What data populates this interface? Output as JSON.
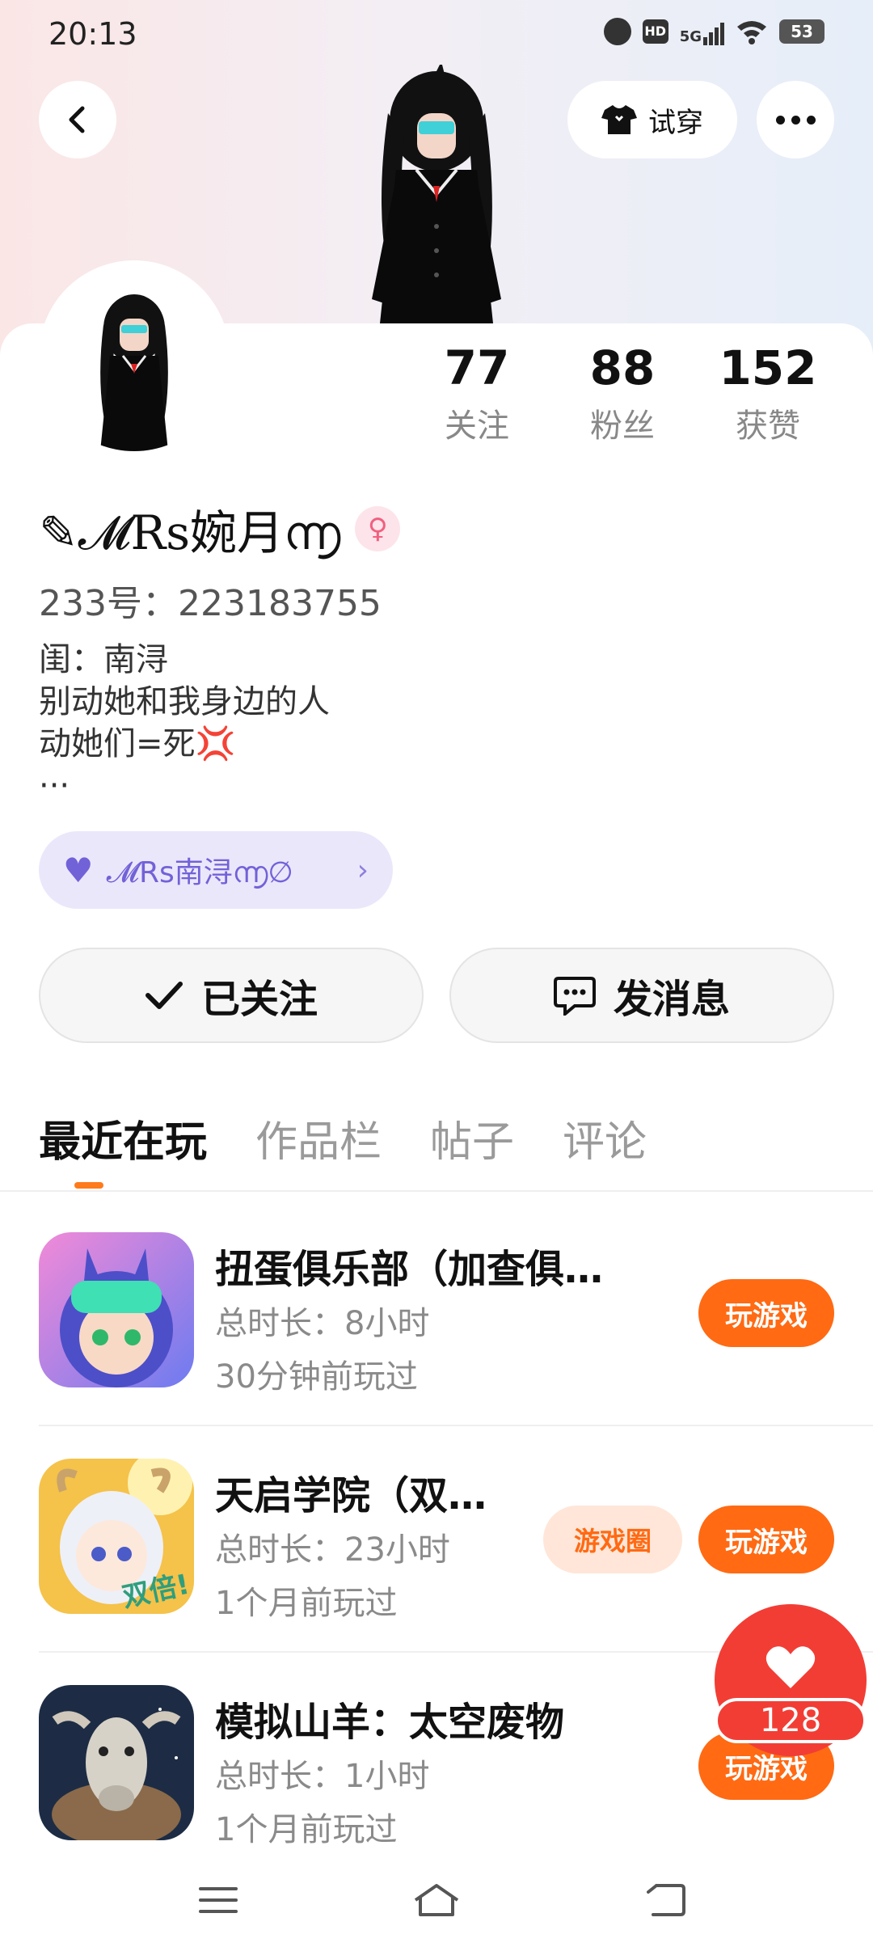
{
  "status_bar": {
    "time": "20:13",
    "network": "5G",
    "hd_label": "HD",
    "battery": "53"
  },
  "header": {
    "tryon_label": "试穿",
    "icons": [
      "back-icon",
      "tshirt-icon",
      "more-icon"
    ]
  },
  "profile": {
    "stats": [
      {
        "value": "77",
        "label": "关注"
      },
      {
        "value": "88",
        "label": "粉丝"
      },
      {
        "value": "152",
        "label": "获赞"
      }
    ],
    "username": "✎𝓜Rs婉月൬",
    "gender_symbol": "♀",
    "uid": "233号：223183755",
    "bio_lines": [
      "闺：南浔",
      "别动她和我身边的人",
      "动她们=死"
    ],
    "bio_more": "···",
    "cp_name": "𝓜Rs南浔൬∅"
  },
  "actions": {
    "follow_label": "已关注",
    "message_label": "发消息"
  },
  "tabs": [
    {
      "label": "最近在玩",
      "active": true
    },
    {
      "label": "作品栏",
      "active": false
    },
    {
      "label": "帖子",
      "active": false
    },
    {
      "label": "评论",
      "active": false
    }
  ],
  "games": [
    {
      "title": "扭蛋俱乐部（加查俱…",
      "duration": "总时长：8小时",
      "last_played": "30分钟前玩过",
      "play_label": "玩游戏"
    },
    {
      "title": "天启学院（双…",
      "duration": "总时长：23小时",
      "last_played": "1个月前玩过",
      "play_label": "玩游戏",
      "circle_label": "游戏圈",
      "icon_badge": "双倍!"
    },
    {
      "title": "模拟山羊：太空废物",
      "duration": "总时长：1小时",
      "last_played": "1个月前玩过",
      "play_label": "玩游戏"
    }
  ],
  "like": {
    "count": "128"
  },
  "colors": {
    "accent": "#ff6a13",
    "like": "#f23d35",
    "cp_pill": "#ebe7fb",
    "cp_text": "#7162d8"
  }
}
